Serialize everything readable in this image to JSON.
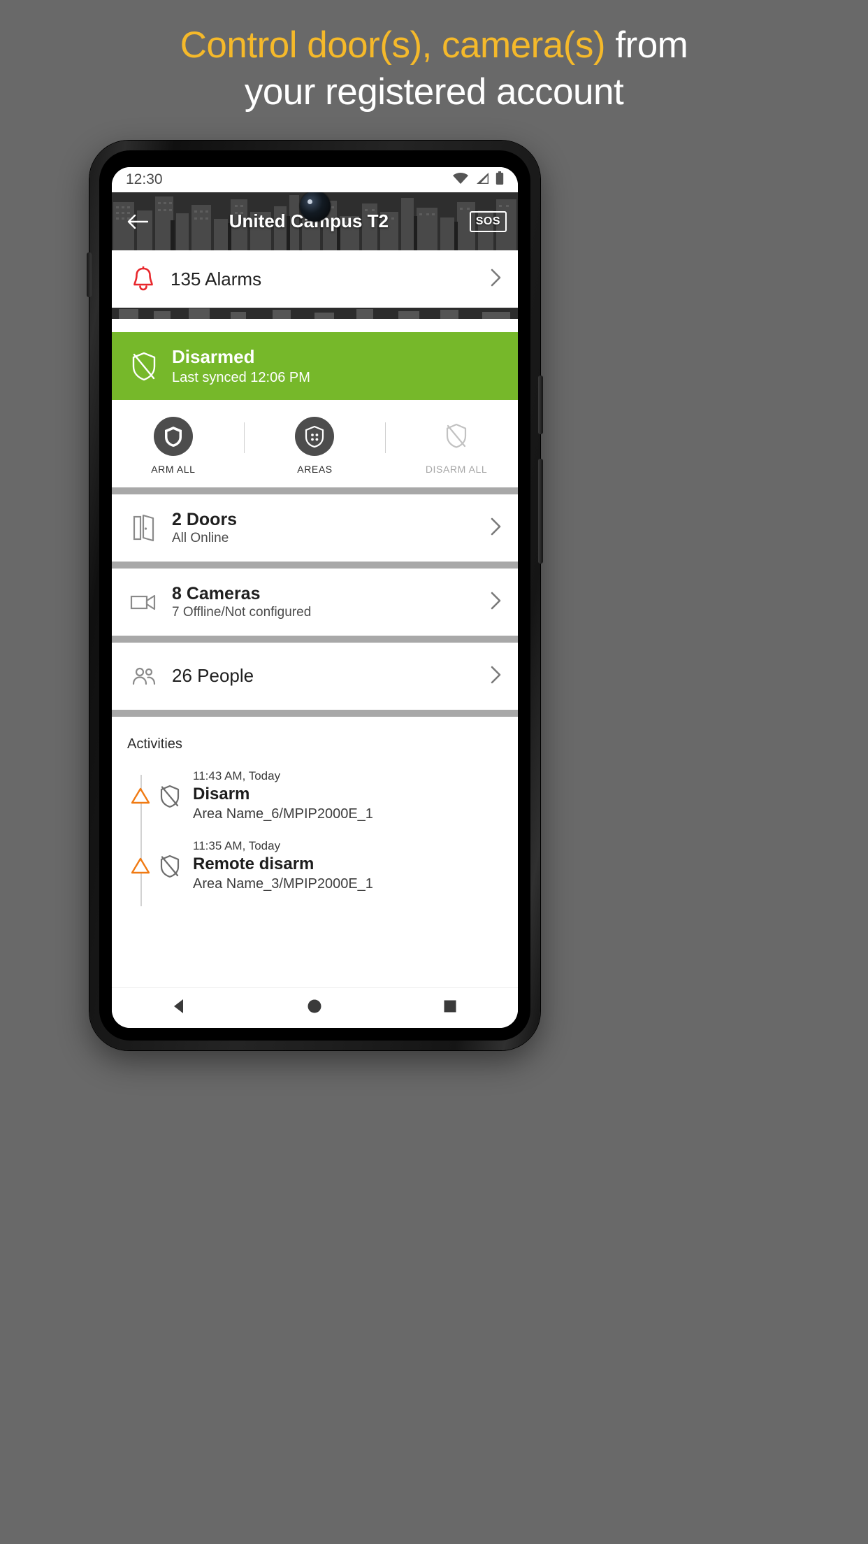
{
  "promo": {
    "line1_accent": "Control door(s), camera(s)",
    "line1_rest": " from",
    "line2": "your registered account",
    "accent_color": "#f5b92a",
    "text_color": "#ffffff",
    "background_color": "#696969"
  },
  "statusbar": {
    "time": "12:30",
    "icons": [
      "wifi-icon",
      "signal-icon",
      "battery-icon"
    ]
  },
  "header": {
    "back_icon": "back-arrow-icon",
    "title": "United Campus T2",
    "sos_label": "SOS"
  },
  "alarms": {
    "icon": "bell-icon",
    "label": "135 Alarms",
    "count": 135,
    "chevron": "chevron-right-icon",
    "icon_color": "#e8272c"
  },
  "status_banner": {
    "icon": "shield-slash-icon",
    "title": "Disarmed",
    "subtitle": "Last synced 12:06 PM",
    "color": "#76b82a"
  },
  "quick_actions": [
    {
      "icon": "shield-icon",
      "label": "ARM ALL",
      "enabled": true
    },
    {
      "icon": "shield-areas-icon",
      "label": "AREAS",
      "enabled": true
    },
    {
      "icon": "shield-slash-icon",
      "label": "DISARM ALL",
      "enabled": false
    }
  ],
  "list_rows": [
    {
      "icon": "door-icon",
      "title": "2 Doors",
      "subtitle": "All Online",
      "chevron": "chevron-right-icon"
    },
    {
      "icon": "camera-icon",
      "title": "8 Cameras",
      "subtitle": "7 Offline/Not configured",
      "chevron": "chevron-right-icon"
    },
    {
      "icon": "people-icon",
      "title": "26 People",
      "subtitle": "",
      "chevron": "chevron-right-icon"
    }
  ],
  "activities": {
    "heading": "Activities",
    "items": [
      {
        "warn_icon": "warning-triangle-icon",
        "type_icon": "shield-slash-icon",
        "time": "11:43 AM, Today",
        "title": "Disarm",
        "subtitle": "Area Name_6/MPIP2000E_1"
      },
      {
        "warn_icon": "warning-triangle-icon",
        "type_icon": "shield-slash-icon",
        "time": "11:35 AM, Today",
        "title": "Remote disarm",
        "subtitle": "Area Name_3/MPIP2000E_1"
      }
    ]
  },
  "navbar": {
    "back": "nav-back-icon",
    "home": "nav-home-icon",
    "recents": "nav-recents-icon"
  }
}
